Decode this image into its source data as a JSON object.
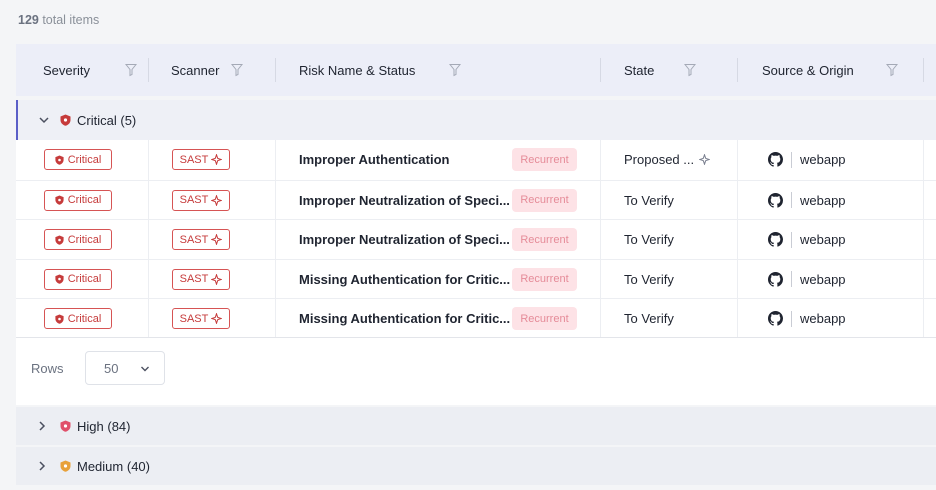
{
  "summary": {
    "count": "129",
    "suffix": " total items"
  },
  "columns": {
    "severity": "Severity",
    "scanner": "Scanner",
    "risk": "Risk Name & Status",
    "state": "State",
    "source": "Source & Origin"
  },
  "groups": {
    "critical": {
      "label": "Critical",
      "count": "(5)"
    },
    "high": {
      "label": "High",
      "count": "(84)"
    },
    "medium": {
      "label": "Medium",
      "count": "(40)"
    }
  },
  "rows": [
    {
      "severity": "Critical",
      "scanner": "SAST",
      "risk": "Improper Authentication",
      "status": "Recurrent",
      "state": "Proposed ...",
      "state_icon": true,
      "source": "webapp"
    },
    {
      "severity": "Critical",
      "scanner": "SAST",
      "risk": "Improper Neutralization of Speci...",
      "status": "Recurrent",
      "state": "To Verify",
      "state_icon": false,
      "source": "webapp"
    },
    {
      "severity": "Critical",
      "scanner": "SAST",
      "risk": "Improper Neutralization of Speci...",
      "status": "Recurrent",
      "state": "To Verify",
      "state_icon": false,
      "source": "webapp"
    },
    {
      "severity": "Critical",
      "scanner": "SAST",
      "risk": "Missing Authentication for Critic...",
      "status": "Recurrent",
      "state": "To Verify",
      "state_icon": false,
      "source": "webapp"
    },
    {
      "severity": "Critical",
      "scanner": "SAST",
      "risk": "Missing Authentication for Critic...",
      "status": "Recurrent",
      "state": "To Verify",
      "state_icon": false,
      "source": "webapp"
    }
  ],
  "pagination": {
    "label": "Rows",
    "value": "50"
  },
  "colors": {
    "critical": "#c63b3b",
    "high": "#e0506a",
    "medium": "#e8a13a",
    "accent": "#5b5fc7"
  },
  "icons": {
    "filter": "funnel-icon",
    "scanner": "sparkle-icon",
    "source": "github-icon",
    "group": "shield-icon"
  }
}
